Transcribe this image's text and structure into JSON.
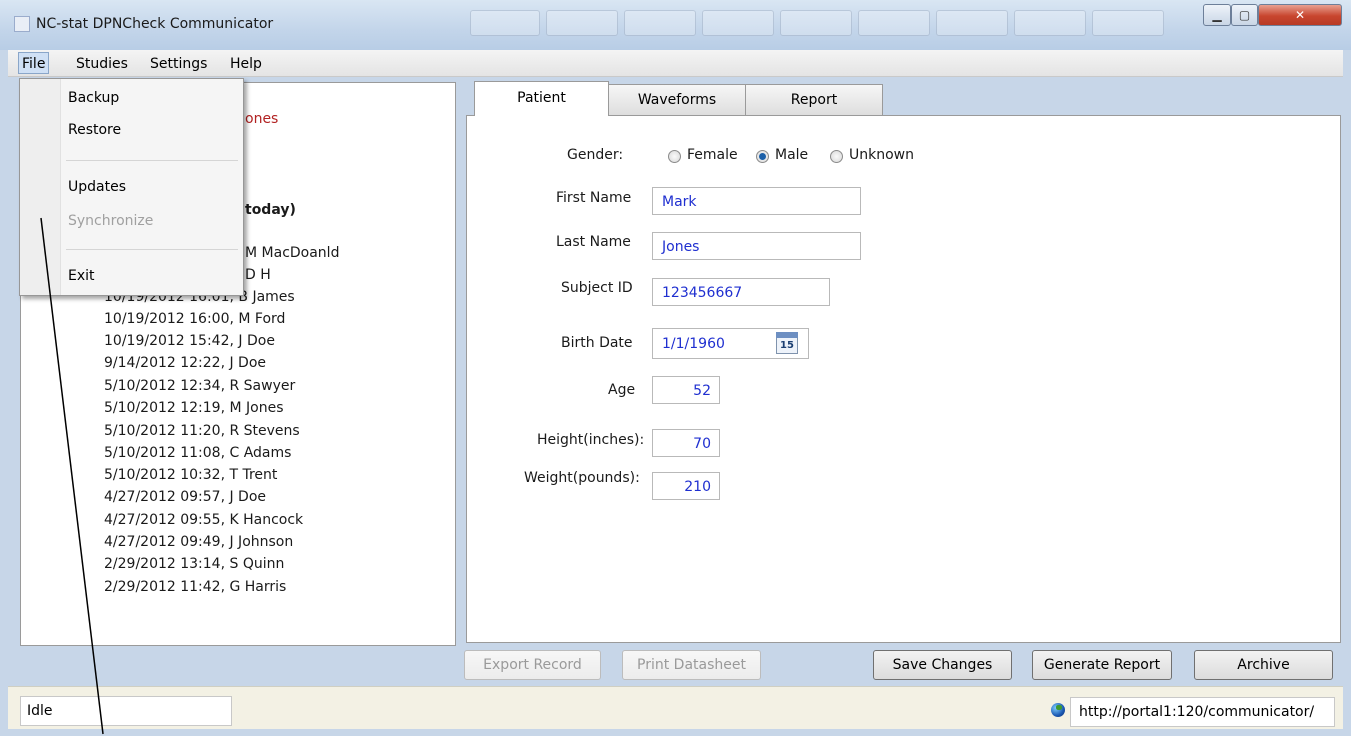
{
  "window": {
    "title": "NC-stat DPNCheck Communicator"
  },
  "menubar": {
    "items": [
      "File",
      "Studies",
      "Settings",
      "Help"
    ]
  },
  "file_menu": {
    "items": [
      {
        "label": "Backup",
        "enabled": true
      },
      {
        "label": "Restore",
        "enabled": true
      },
      {
        "label": "Updates",
        "enabled": true
      },
      {
        "label": "Synchronize",
        "enabled": false
      },
      {
        "label": "Exit",
        "enabled": true
      }
    ]
  },
  "studies": {
    "partial_fragments": [
      "ones",
      "today)",
      "M MacDoanld",
      "D H"
    ],
    "items": [
      "10/19/2012 16:01, B James",
      "10/19/2012 16:00, M Ford",
      "10/19/2012 15:42, J Doe",
      "9/14/2012 12:22, J Doe",
      "5/10/2012 12:34, R Sawyer",
      "5/10/2012 12:19, M Jones",
      "5/10/2012 11:20, R Stevens",
      "5/10/2012 11:08, C Adams",
      "5/10/2012 10:32, T Trent",
      "4/27/2012 09:57, J Doe",
      "4/27/2012 09:55, K Hancock",
      "4/27/2012 09:49, J Johnson",
      "2/29/2012 13:14, S Quinn",
      "2/29/2012 11:42, G Harris"
    ]
  },
  "tabs": [
    "Patient",
    "Waveforms",
    "Report"
  ],
  "patient": {
    "gender_label": "Gender:",
    "gender_options": [
      "Female",
      "Male",
      "Unknown"
    ],
    "gender_selected": "Male",
    "first_name_label": "First Name",
    "first_name": "Mark",
    "last_name_label": "Last Name",
    "last_name": "Jones",
    "subject_id_label": "Subject ID",
    "subject_id": "123456667",
    "birth_date_label": "Birth Date",
    "birth_date": "1/1/1960",
    "calendar_day": "15",
    "age_label": "Age",
    "age": "52",
    "height_label": "Height(inches):",
    "height": "70",
    "weight_label": "Weight(pounds):",
    "weight": "210"
  },
  "buttons": {
    "export_record": "Export Record",
    "print_datasheet": "Print Datasheet",
    "save_changes": "Save Changes",
    "generate_report": "Generate Report",
    "archive": "Archive"
  },
  "statusbar": {
    "status": "Idle",
    "url": "http://portal1:120/communicator/"
  },
  "colors": {
    "input_text": "#1f2fd0",
    "partial_name_text": "#b22222"
  }
}
